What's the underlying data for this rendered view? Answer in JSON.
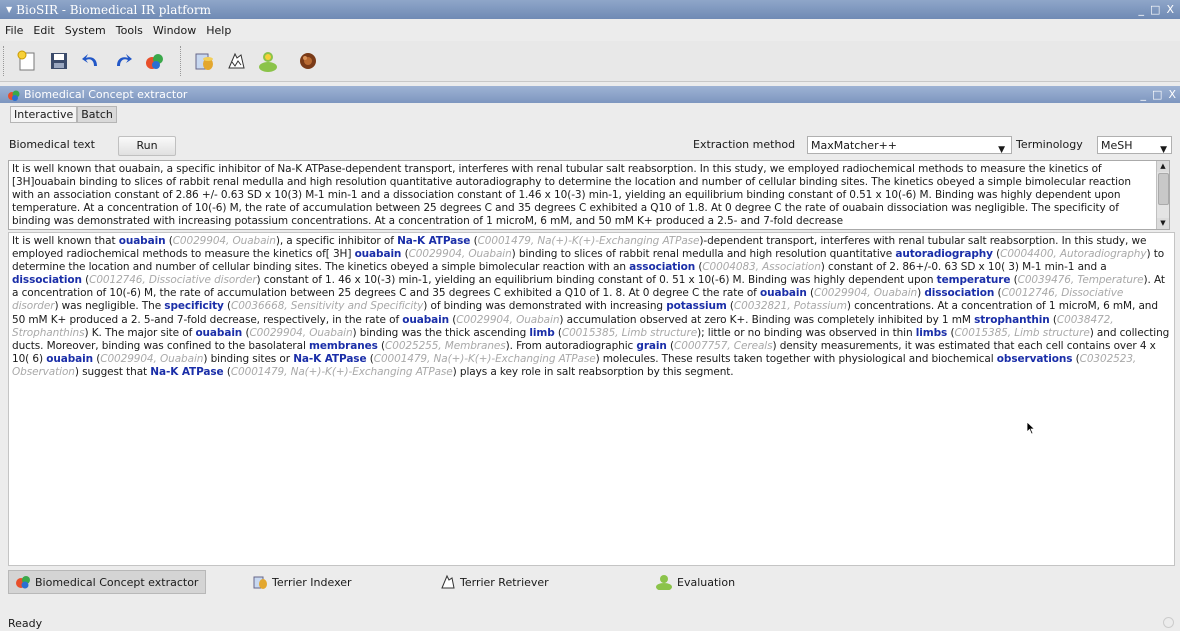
{
  "window": {
    "title": "BioSIR - Biomedical IR platform",
    "controls": [
      "_",
      "□",
      "X"
    ]
  },
  "menu": [
    "File",
    "Edit",
    "System",
    "Tools",
    "Window",
    "Help"
  ],
  "toolbar_icons": [
    "new-document-icon",
    "save-icon",
    "undo-icon",
    "redo-icon",
    "concept-extractor-icon",
    "indexer-icon",
    "retriever-icon",
    "evaluation-icon",
    "tool-icon"
  ],
  "panel": {
    "title": "Biomedical Concept extractor",
    "controls": [
      "_",
      "□",
      "X"
    ]
  },
  "tabs": [
    {
      "label": "Interactive",
      "active": true
    },
    {
      "label": "Batch",
      "active": false
    }
  ],
  "controls": {
    "biomedical_text_label": "Biomedical text",
    "run_label": "Run",
    "extraction_label": "Extraction method",
    "extraction_value": "MaxMatcher++",
    "terminology_label": "Terminology",
    "terminology_value": "MeSH"
  },
  "input_text": "It is well known that ouabain, a specific inhibitor of Na-K ATPase-dependent transport, interferes with renal tubular salt reabsorption. In this study, we employed radiochemical methods to measure the kinetics of [3H]ouabain binding to slices of rabbit renal medulla and high resolution quantitative autoradiography to determine the location and number of cellular binding sites. The kinetics obeyed a simple bimolecular reaction with an association constant of 2.86 +/- 0.63 SD x 10(3) M-1 min-1 and a dissociation constant of 1.46 x 10(-3) min-1, yielding an equilibrium binding constant of 0.51 x 10(-6) M. Binding was highly dependent upon temperature. At a concentration of 10(-6) M, the rate of accumulation between 25 degrees C and 35 degrees C exhibited a Q10 of 1.8. At 0 degree C the rate of ouabain dissociation was negligible. The specificity of binding was demonstrated with increasing potassium concentrations. At a concentration of 1 microM, 6 mM, and 50 mM K+ produced a 2.5- and 7-fold decrease",
  "output_segments": [
    {
      "t": "It is well known that "
    },
    {
      "term": "ouabain",
      "info": "C0029904, Ouabain"
    },
    {
      "t": ", a specific inhibitor of "
    },
    {
      "term": "Na-K ATPase",
      "info": "C0001479, Na(+)-K(+)-Exchanging ATPase"
    },
    {
      "t": "-dependent transport, interferes with renal tubular salt reabsorption. In this study, we employed radiochemical methods to measure the kinetics of[ 3H] "
    },
    {
      "term": "ouabain",
      "info": "C0029904, Ouabain"
    },
    {
      "t": " binding to slices of rabbit renal medulla and high resolution quantitative "
    },
    {
      "term": "autoradiography",
      "info": "C0004400, Autoradiography"
    },
    {
      "t": " to determine the location and number of cellular binding sites. The kinetics obeyed a simple bimolecular reaction with an "
    },
    {
      "term": "association",
      "info": "C0004083, Association"
    },
    {
      "t": " constant of 2. 86+/-0. 63 SD x 10( 3) M-1 min-1 and a "
    },
    {
      "term": "dissociation",
      "info": "C0012746, Dissociative disorder"
    },
    {
      "t": " constant of 1. 46 x 10(-3) min-1, yielding an equilibrium binding constant of 0. 51 x 10(-6) M. Binding was highly dependent upon "
    },
    {
      "term": "temperature",
      "info": "C0039476, Temperature"
    },
    {
      "t": ". At a concentration of 10(-6) M, the rate of accumulation between 25 degrees C and 35 degrees C exhibited a Q10 of 1. 8. At 0 degree C the rate of "
    },
    {
      "term": "ouabain",
      "info": "C0029904, Ouabain"
    },
    {
      "t": " "
    },
    {
      "term": "dissociation",
      "info": "C0012746, Dissociative disorder"
    },
    {
      "t": " was negligible. The "
    },
    {
      "term": "specificity",
      "info": "C0036668, Sensitivity and Specificity"
    },
    {
      "t": " of binding was demonstrated with increasing "
    },
    {
      "term": "potassium",
      "info": "C0032821, Potassium"
    },
    {
      "t": " concentrations. At a concentration of 1 microM, 6 mM, and 50 mM K+ produced a 2. 5-and 7-fold decrease, respectively, in the rate of "
    },
    {
      "term": "ouabain",
      "info": "C0029904, Ouabain"
    },
    {
      "t": " accumulation observed at zero K+. Binding was completely inhibited by 1 mM "
    },
    {
      "term": "strophanthin",
      "info": "C0038472, Strophanthins"
    },
    {
      "t": " K. The major site of "
    },
    {
      "term": "ouabain",
      "info": "C0029904, Ouabain"
    },
    {
      "t": " binding was the thick ascending "
    },
    {
      "term": "limb",
      "info": "C0015385, Limb structure"
    },
    {
      "t": "; little or no binding was observed in thin "
    },
    {
      "term": "limbs",
      "info": "C0015385, Limb structure"
    },
    {
      "t": " and collecting ducts. Moreover, binding was confined to the basolateral "
    },
    {
      "term": "membranes",
      "info": "C0025255, Membranes"
    },
    {
      "t": ". From autoradiographic "
    },
    {
      "term": "grain",
      "info": "C0007757, Cereals"
    },
    {
      "t": " density measurements, it was estimated that each cell contains over 4 x 10( 6) "
    },
    {
      "term": "ouabain",
      "info": "C0029904, Ouabain"
    },
    {
      "t": " binding sites or "
    },
    {
      "term": "Na-K ATPase",
      "info": "C0001479, Na(+)-K(+)-Exchanging ATPase"
    },
    {
      "t": " molecules. These results taken together with physiological and biochemical "
    },
    {
      "term": "observations",
      "info": "C0302523, Observation"
    },
    {
      "t": " suggest that "
    },
    {
      "term": "Na-K ATPase",
      "info": "C0001479, Na(+)-K(+)-Exchanging ATPase"
    },
    {
      "t": " plays a key role in salt reabsorption by this segment."
    }
  ],
  "bottom_tabs": [
    {
      "label": "Biomedical Concept extractor",
      "active": true
    },
    {
      "label": "Terrier Indexer",
      "active": false
    },
    {
      "label": "Terrier Retriever",
      "active": false
    },
    {
      "label": "Evaluation",
      "active": false
    }
  ],
  "status": "Ready"
}
